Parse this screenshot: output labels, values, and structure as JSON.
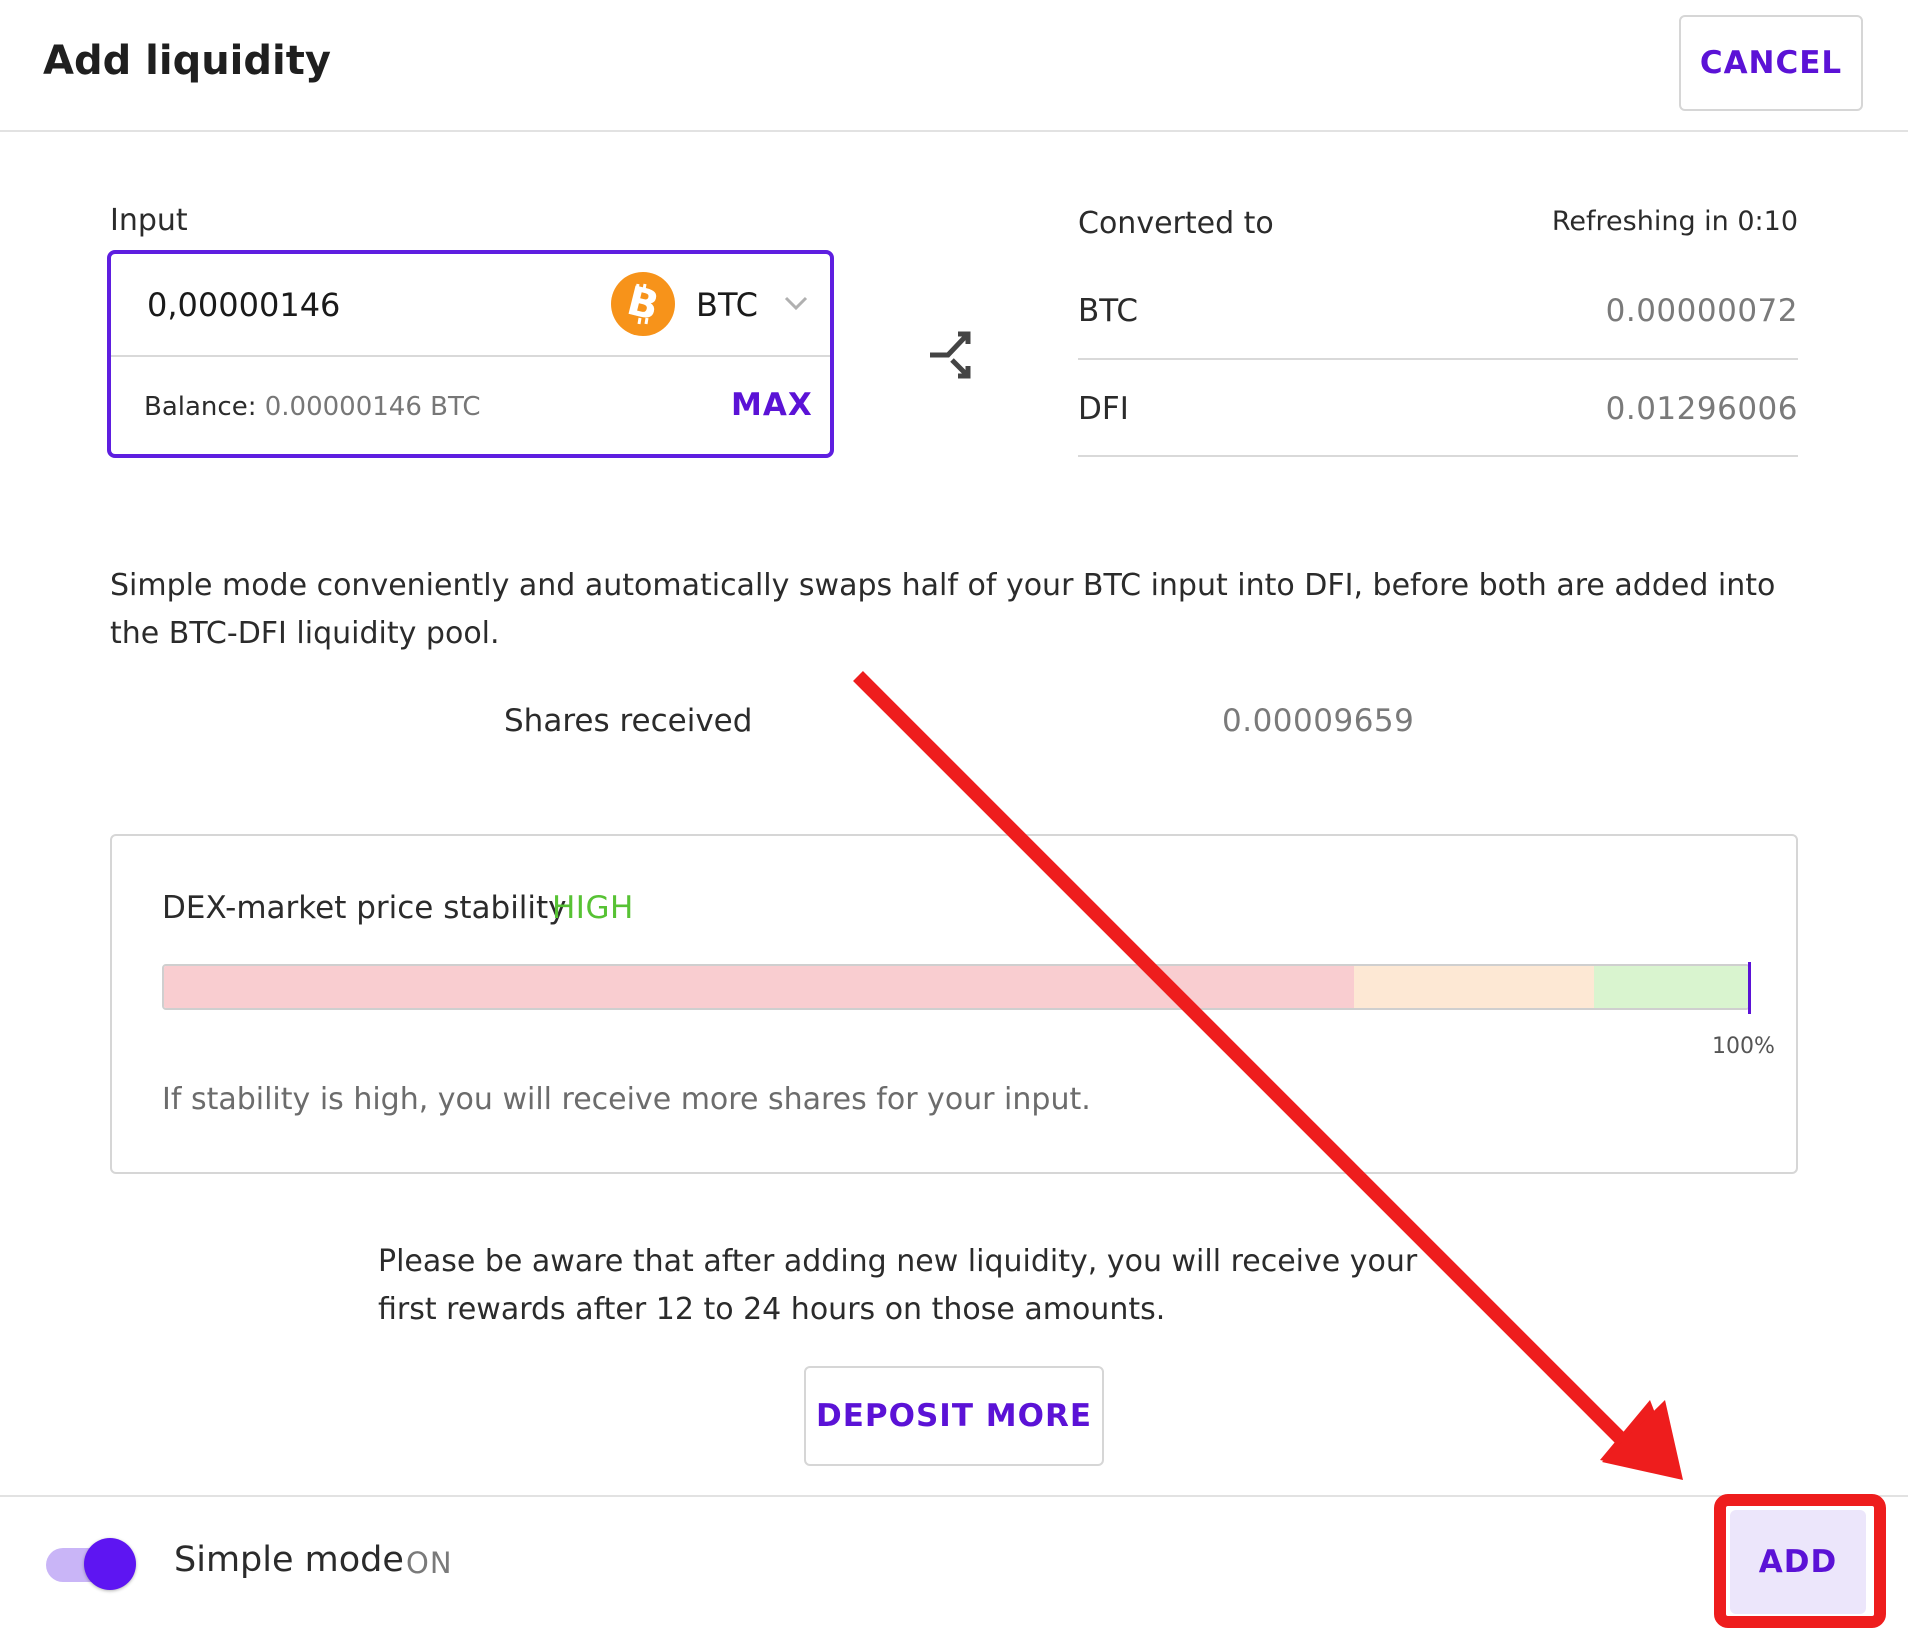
{
  "header": {
    "title": "Add liquidity",
    "cancel_label": "CANCEL"
  },
  "input": {
    "label": "Input",
    "value": "0,00000146",
    "token": "BTC",
    "token_icon": "bitcoin-icon",
    "balance_label": "Balance:",
    "balance_value": "0.00000146 BTC",
    "max_label": "MAX"
  },
  "converted": {
    "label": "Converted to",
    "refresh": "Refreshing in 0:10",
    "rows": [
      {
        "token": "BTC",
        "amount": "0.00000072"
      },
      {
        "token": "DFI",
        "amount": "0.01296006"
      }
    ]
  },
  "description": "Simple mode conveniently and automatically swaps half of your BTC input into DFI, before both are added into the BTC-DFI liquidity pool.",
  "shares": {
    "label": "Shares received",
    "value": "0.00009659"
  },
  "stability": {
    "title": "DEX-market price stability",
    "level": "HIGH",
    "level_color": "#57c234",
    "percent_label": "100%",
    "percent_value": 100,
    "note": "If stability is high, you will receive more shares for your input."
  },
  "reward_notice": "Please be aware that after adding new liquidity, you will receive your first rewards after 12 to 24 hours on those amounts.",
  "deposit_more_label": "DEPOSIT MORE",
  "footer": {
    "simple_mode_label": "Simple mode",
    "simple_mode_state": "ON",
    "add_label": "ADD"
  },
  "colors": {
    "accent": "#5b12d6",
    "annotation": "#ee1d1d"
  }
}
